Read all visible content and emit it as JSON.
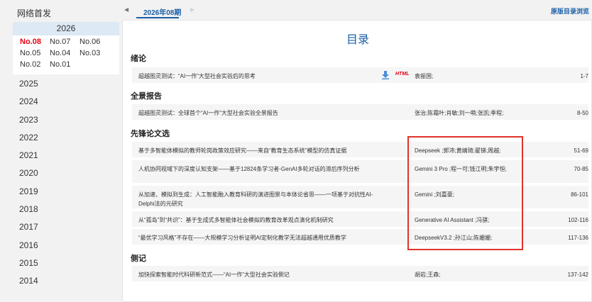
{
  "sidebar": {
    "title": "网络首发",
    "current_year": "2026",
    "issues": [
      "No.08",
      "No.07",
      "No.06",
      "No.05",
      "No.04",
      "No.03",
      "No.02",
      "No.01"
    ],
    "active_issue": "No.08",
    "years": [
      "2025",
      "2024",
      "2023",
      "2022",
      "2021",
      "2020",
      "2019",
      "2018",
      "2017",
      "2016",
      "2015",
      "2014"
    ]
  },
  "topbar": {
    "issue_tab": "2026年08期",
    "orig_link": "原版目录浏览"
  },
  "toc": {
    "title": "目录",
    "html_badge": "HTML",
    "sections": [
      {
        "name": "绪论",
        "articles": [
          {
            "title": "超越图灵测试：“AI一作”大型社会实验后的思考",
            "authors": "袁振国;",
            "pages": "1-7"
          }
        ]
      },
      {
        "name": "全景报告",
        "articles": [
          {
            "title": "超越图灵测试：全球首个“AI一作”大型社会实验全景报告",
            "authors": "张治;陈霜叶;肖敏;刘一萌;张凯;季程;",
            "pages": "8-50"
          }
        ]
      },
      {
        "name": "先锋论文选",
        "articles": [
          {
            "title": "基于多智能体模拟的教师轮岗政策效应研究——来自“教育生态系统”模型的仿真证据",
            "authors": "Deepseek ;郭沛;黄婧琦;翟锑;周越;",
            "pages": "51-69"
          },
          {
            "title": "人机协同视域下的深度认知支架——基于12824条学习者-GenAI多轮对话的滞后序列分析",
            "authors": "Gemini 3 Pro ;程一可;钱江明;朱宇恒;",
            "pages": "70-85"
          },
          {
            "title": "从加速、模拟到生成：人工智能融入教育科研的演进图景与本体论省思——一项基于对抗性AI-Delphi法的元研究",
            "authors": "Gemini ;刘嘉豪;",
            "pages": "86-101"
          },
          {
            "title": "从“孤岛”到“共识”：基于生成式多智能体社会模拟的教育改革观点演化机制研究",
            "authors": "Generative AI Assistant ;冯骐;",
            "pages": "102-116"
          },
          {
            "title": "“最优学习风格”不存在——大规模学习分析证明AI定制化教学无法超越通用优质教学",
            "authors": "DeepseekV3.2 ;孙江山;陈姗姗;",
            "pages": "117-136"
          }
        ]
      },
      {
        "name": "侧记",
        "articles": [
          {
            "title": "加快探索智能时代科研新范式——“AI一作”大型社会实验侧记",
            "authors": "胡岩;王森;",
            "pages": "137-142"
          }
        ]
      }
    ]
  },
  "colors": {
    "accent": "#1a5fa8",
    "active": "#e60012",
    "highlight_box": "#e0332a"
  }
}
